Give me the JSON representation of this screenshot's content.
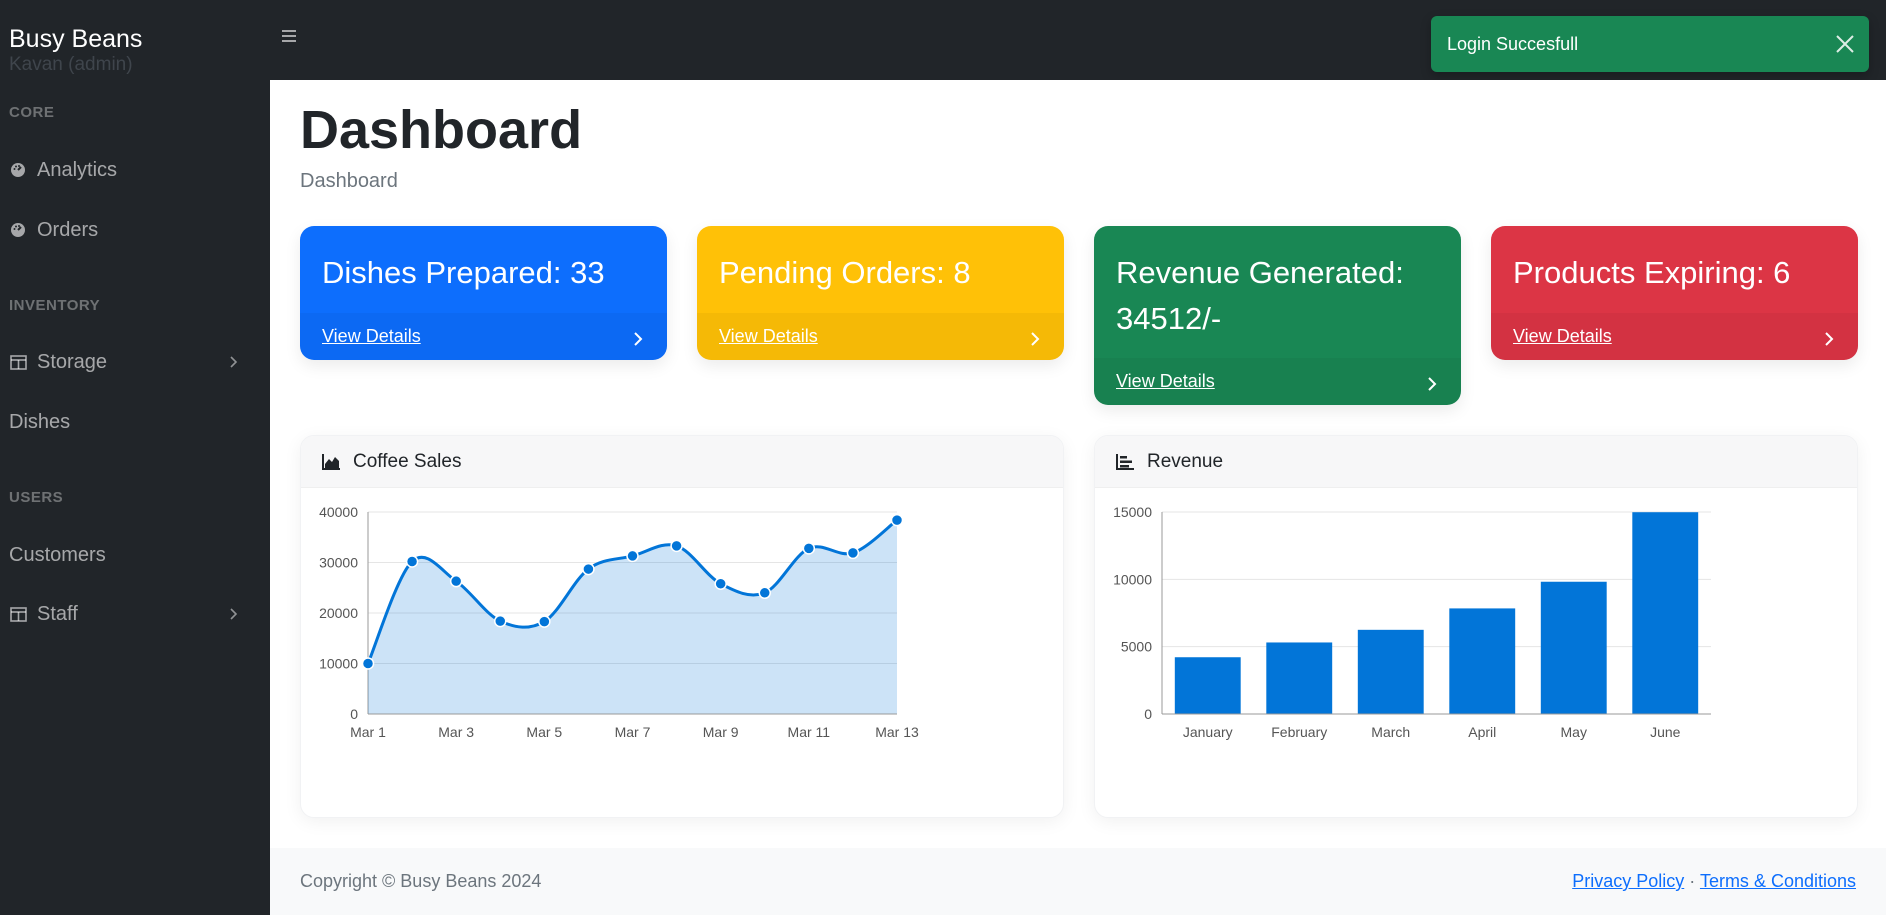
{
  "brand": {
    "title": "Busy Beans",
    "subtitle": "Kavan (admin)"
  },
  "sidebar": {
    "sections": [
      {
        "heading": "CORE",
        "items": [
          {
            "label": "Analytics",
            "icon": "gauge-icon"
          },
          {
            "label": "Orders",
            "icon": "gauge-icon"
          }
        ]
      },
      {
        "heading": "INVENTORY",
        "items": [
          {
            "label": "Storage",
            "icon": "columns-icon",
            "chevron": true
          },
          {
            "label": "Dishes"
          }
        ]
      },
      {
        "heading": "USERS",
        "items": [
          {
            "label": "Customers"
          },
          {
            "label": "Staff",
            "icon": "columns-icon",
            "chevron": true
          }
        ]
      }
    ]
  },
  "toast": {
    "message": "Login Succesfull",
    "color": "#198754"
  },
  "page": {
    "title": "Dashboard",
    "breadcrumb": "Dashboard"
  },
  "cards": [
    {
      "text": "Dishes Prepared: 33",
      "link": "View Details",
      "color": "#0d6efd"
    },
    {
      "text": "Pending Orders: 8",
      "link": "View Details",
      "color": "#ffc107"
    },
    {
      "text": "Revenue Generated: 34512/-",
      "link": "View Details",
      "color": "#198754"
    },
    {
      "text": "Products Expiring: 6",
      "link": "View Details",
      "color": "#dc3545"
    }
  ],
  "panels": {
    "coffee": {
      "title": "Coffee Sales",
      "icon": "area-chart-icon"
    },
    "revenue": {
      "title": "Revenue",
      "icon": "bar-chart-icon"
    }
  },
  "chart_data": [
    {
      "type": "area",
      "title": "Coffee Sales",
      "x": [
        "Mar 1",
        "Mar 2",
        "Mar 3",
        "Mar 4",
        "Mar 5",
        "Mar 6",
        "Mar 7",
        "Mar 8",
        "Mar 9",
        "Mar 10",
        "Mar 11",
        "Mar 12",
        "Mar 13"
      ],
      "tick_labels": [
        "Mar 1",
        "Mar 3",
        "Mar 5",
        "Mar 7",
        "Mar 9",
        "Mar 11",
        "Mar 13"
      ],
      "values": [
        10000,
        30200,
        26300,
        18400,
        18300,
        28700,
        31300,
        33300,
        25800,
        24000,
        32800,
        31900,
        38400
      ],
      "ylim": [
        0,
        40000
      ],
      "yticks": [
        0,
        10000,
        20000,
        30000,
        40000
      ],
      "color": "#0275d8",
      "grid": true
    },
    {
      "type": "bar",
      "title": "Revenue",
      "categories": [
        "January",
        "February",
        "March",
        "April",
        "May",
        "June"
      ],
      "values": [
        4215,
        5312,
        6251,
        7841,
        9821,
        14984
      ],
      "ylim": [
        0,
        15000
      ],
      "yticks": [
        0,
        5000,
        10000,
        15000
      ],
      "color": "#0275d8",
      "grid": true
    }
  ],
  "footer": {
    "copyright": "Copyright © Busy Beans 2024",
    "privacy": "Privacy Policy",
    "separator": "·",
    "terms": "Terms & Conditions"
  }
}
